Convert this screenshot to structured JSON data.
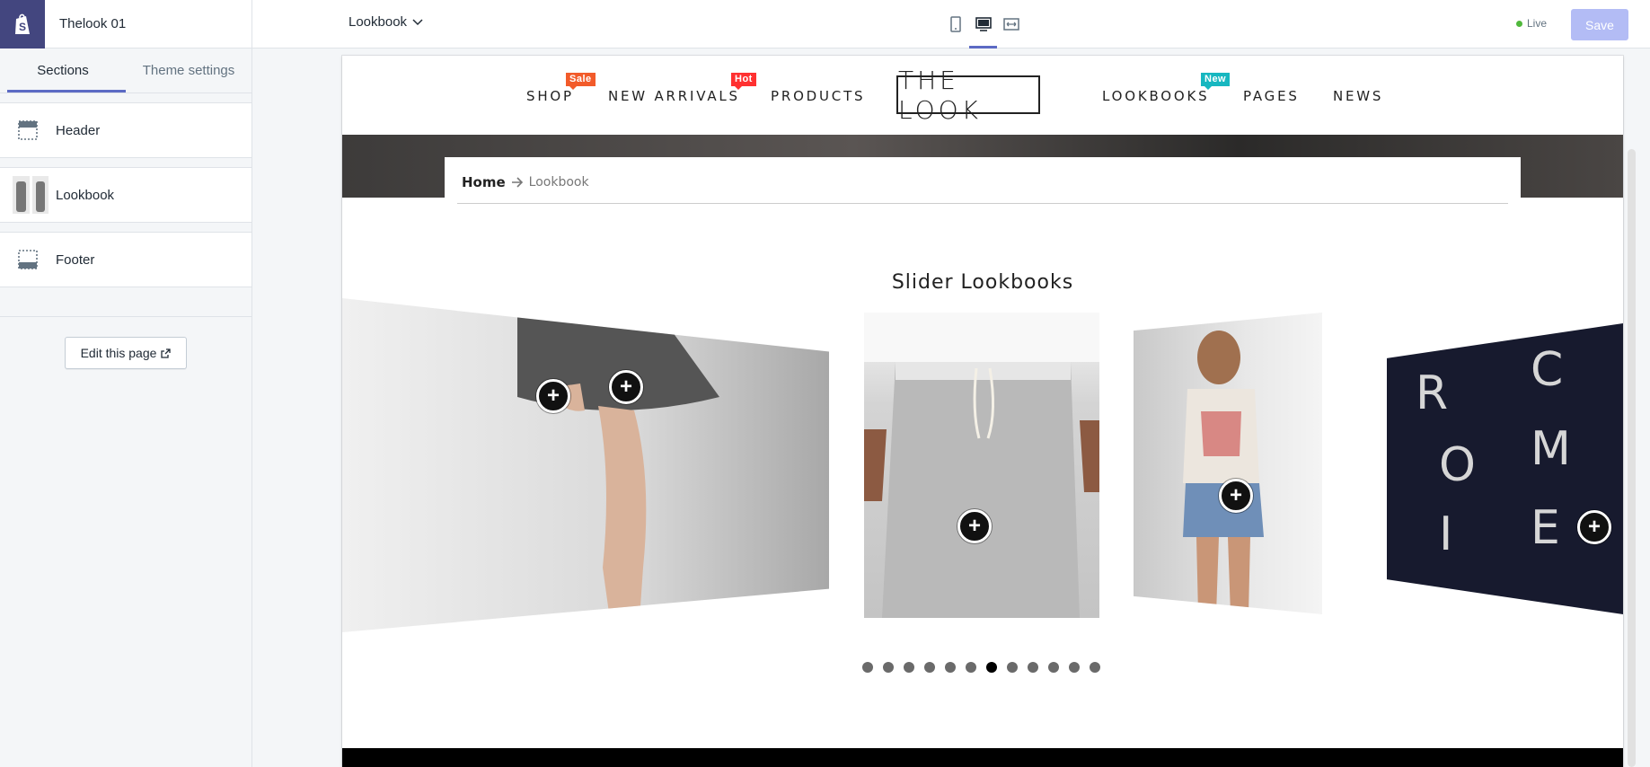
{
  "sidebar": {
    "theme_name": "Thelook 01",
    "tabs": [
      "Sections",
      "Theme settings"
    ],
    "sections": [
      {
        "label": "Header",
        "icon": "header-layout-icon"
      },
      {
        "label": "Lookbook",
        "icon": "lookbook-thumbnail"
      },
      {
        "label": "Footer",
        "icon": "footer-layout-icon"
      }
    ],
    "edit_button": "Edit this page"
  },
  "topbar": {
    "page_select": "Lookbook",
    "devices": [
      "mobile-icon",
      "desktop-icon",
      "fullwidth-icon"
    ],
    "active_device": "desktop",
    "live_label": "Live",
    "save_label": "Save"
  },
  "preview": {
    "nav": {
      "items": [
        "SHOP",
        "NEW ARRIVALS",
        "PRODUCTS",
        "LOOKBOOKS",
        "PAGES",
        "NEWS"
      ],
      "logo": "THE LOOK",
      "badges": {
        "sale": "Sale",
        "hot": "Hot",
        "new": "New"
      }
    },
    "breadcrumb": {
      "home": "Home",
      "current": "Lookbook"
    },
    "slider_title": "Slider Lookbooks",
    "slide4_letters": [
      "R",
      "C",
      "O",
      "M",
      "I",
      "E"
    ],
    "dots_total": 12,
    "dots_active_index": 6
  },
  "colors": {
    "accent": "#5c6ac4",
    "save_disabled": "#b3bcf5",
    "sale_badge": "#f25b2a",
    "hot_badge": "#ff3131",
    "new_badge": "#17b7c0",
    "live_dot": "#50b83c"
  }
}
